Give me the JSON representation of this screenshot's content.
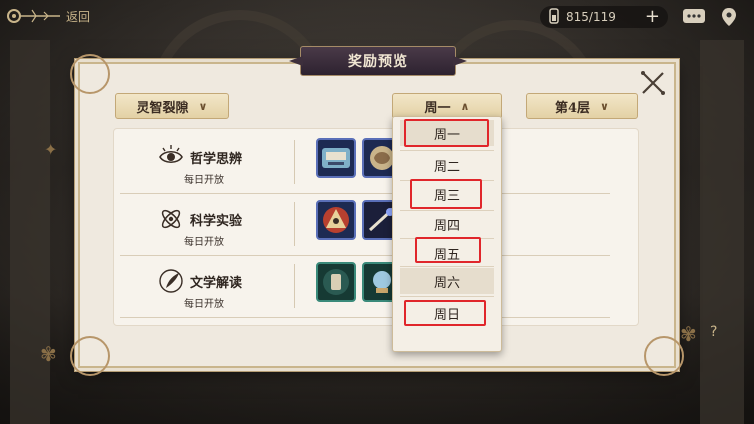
{
  "hud": {
    "back_label": "返回",
    "resource_value": "815/119",
    "resource_plus": "+",
    "chat_icon": "chat-bubble-icon",
    "location_icon": "map-pin-icon"
  },
  "panel": {
    "title": "奖励预览",
    "close_icon": "close-x-icon"
  },
  "filters": {
    "category": {
      "label": "灵智裂隙",
      "arrow": "∨"
    },
    "day": {
      "label": "周一",
      "arrow": "∧"
    },
    "floor": {
      "label": "第4层",
      "arrow": "∨"
    }
  },
  "rows": [
    {
      "name": "哲学思辨",
      "sub": "每日开放",
      "icon": "eye-icon"
    },
    {
      "name": "科学实验",
      "sub": "每日开放",
      "icon": "atom-icon"
    },
    {
      "name": "文学解读",
      "sub": "每日开放",
      "icon": "quill-icon"
    }
  ],
  "day_options": [
    "周一",
    "周二",
    "周三",
    "周四",
    "周五",
    "周六",
    "周日"
  ],
  "colors": {
    "highlight": "#e0262b",
    "panel_bg": "#efe9df",
    "reward_border": "#5a6fb8"
  }
}
